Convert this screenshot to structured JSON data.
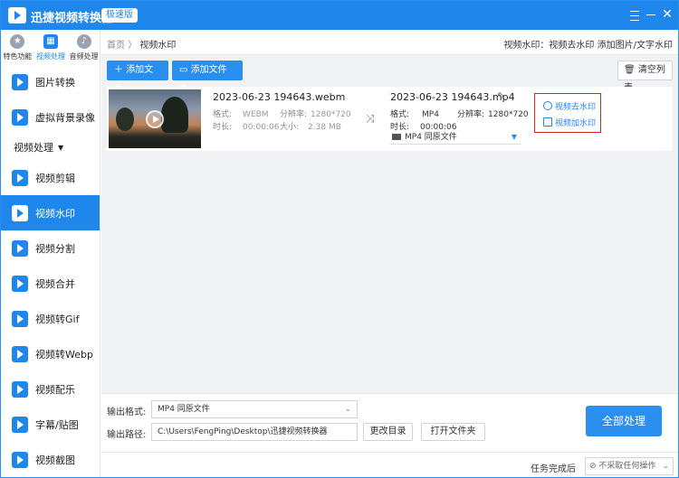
{
  "titlebar": {
    "title": "迅捷视频转换器",
    "badge": "极速版"
  },
  "top_modes": [
    {
      "label": "特色功能",
      "icon": "star-icon"
    },
    {
      "label": "视频处理",
      "icon": "film-icon"
    },
    {
      "label": "音频处理",
      "icon": "audio-icon"
    }
  ],
  "nav": {
    "items_top": [
      "图片转换",
      "虚拟背景录像"
    ],
    "group_label": "视频处理",
    "items": [
      "视频剪辑",
      "视频水印",
      "视频分割",
      "视频合并",
      "视频转Gif",
      "视频转Webp",
      "视频配乐",
      "字幕/贴图",
      "视频截图"
    ],
    "active": "视频水印"
  },
  "breadcrumb": {
    "home": "首页",
    "sep": "〉",
    "current": "视频水印"
  },
  "header_hint": "视频水印：视频去水印 添加图片/文字水印",
  "toolbar": {
    "add_file": "添加文件",
    "add_folder": "添加文件夹",
    "clear": "清空列表"
  },
  "file": {
    "source": {
      "name": "2023-06-23 194643.webm",
      "format_label": "格式:",
      "format": "WEBM",
      "res_label": "分辨率:",
      "resolution": "1280*720",
      "dur_label": "时长:",
      "duration": "00:00:06",
      "size_label": "大小:",
      "size": "2.38 MB"
    },
    "output": {
      "name": "2023-06-23 194643.mp4",
      "format_label": "格式:",
      "format": "MP4",
      "res_label": "分辨率:",
      "resolution": "1280*720",
      "dur_label": "时长:",
      "duration": "00:00:06",
      "preset": "MP4  同原文件"
    },
    "actions": {
      "remove_watermark": "视频去水印",
      "add_watermark": "视频加水印"
    }
  },
  "bottom": {
    "format_label": "输出格式:",
    "format_value": "MP4  同原文件",
    "path_label": "输出路径:",
    "path_value": "C:\\Users\\FengPing\\Desktop\\迅捷视频转换器",
    "change_dir": "更改目录",
    "open_folder": "打开文件夹",
    "process_all": "全部处理",
    "on_complete_label": "任务完成后",
    "on_complete_value": "不采取任何操作"
  },
  "colors": {
    "accent": "#1f86ec",
    "highlight_box": "#e02020"
  }
}
